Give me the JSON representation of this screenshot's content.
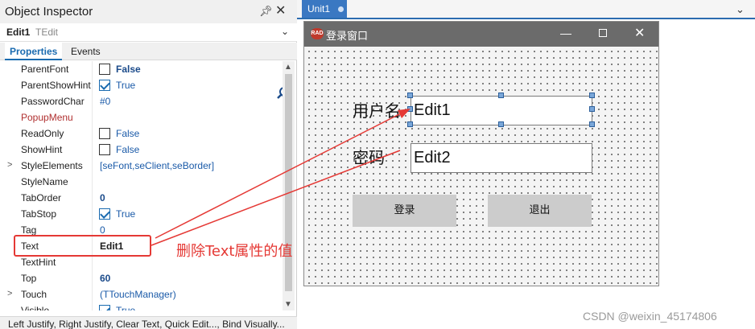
{
  "inspector": {
    "title": "Object Inspector",
    "component_name": "Edit1",
    "component_class": "TEdit",
    "tabs": [
      "Properties",
      "Events"
    ],
    "rows": [
      {
        "expand": "",
        "name": "ParentFont",
        "checkbox": false,
        "value": "False",
        "style": "bold"
      },
      {
        "expand": "",
        "name": "ParentShowHint",
        "checkbox": true,
        "value": "True",
        "style": "normal"
      },
      {
        "expand": "",
        "name": "PasswordChar",
        "value": "#0",
        "style": "normal"
      },
      {
        "expand": "",
        "name": "PopupMenu",
        "value": "",
        "style": "red"
      },
      {
        "expand": "",
        "name": "ReadOnly",
        "checkbox": false,
        "value": "False",
        "style": "normal"
      },
      {
        "expand": "",
        "name": "ShowHint",
        "checkbox": false,
        "value": "False",
        "style": "normal"
      },
      {
        "expand": ">",
        "name": "StyleElements",
        "value": "[seFont,seClient,seBorder]",
        "style": "normal"
      },
      {
        "expand": "",
        "name": "StyleName",
        "value": "",
        "style": "normal"
      },
      {
        "expand": "",
        "name": "TabOrder",
        "value": "0",
        "style": "bold"
      },
      {
        "expand": "",
        "name": "TabStop",
        "checkbox": true,
        "value": "True",
        "style": "normal"
      },
      {
        "expand": "",
        "name": "Tag",
        "value": "0",
        "style": "normal"
      },
      {
        "expand": "",
        "name": "Text",
        "value": "Edit1",
        "style": "dark"
      },
      {
        "expand": "",
        "name": "TextHint",
        "value": "",
        "style": "normal"
      },
      {
        "expand": "",
        "name": "Top",
        "value": "60",
        "style": "bold"
      },
      {
        "expand": ">",
        "name": "Touch",
        "value": "(TTouchManager)",
        "style": "normal"
      },
      {
        "expand": "",
        "name": "Visible",
        "checkbox": true,
        "value": "True",
        "style": "normal"
      }
    ],
    "bottom_links": "Left Justify, Right Justify, Clear Text, Quick Edit..., Bind Visually..."
  },
  "designer": {
    "tab_label": "Unit1",
    "form": {
      "caption": "登录窗口",
      "icon_text": "RAD",
      "label_user": "用户名",
      "label_password": "密码",
      "edit1": "Edit1",
      "edit2": "Edit2",
      "login_button": "登录",
      "exit_button": "退出"
    }
  },
  "annotation": {
    "text": "删除Text属性的值",
    "color": "#e53935"
  },
  "watermark": "CSDN @weixin_45174806",
  "colors": {
    "accent": "#1a6bb0",
    "tab_active": "#3a78c2",
    "form_titlebar": "#6b6b6b",
    "annotation": "#e53935"
  }
}
